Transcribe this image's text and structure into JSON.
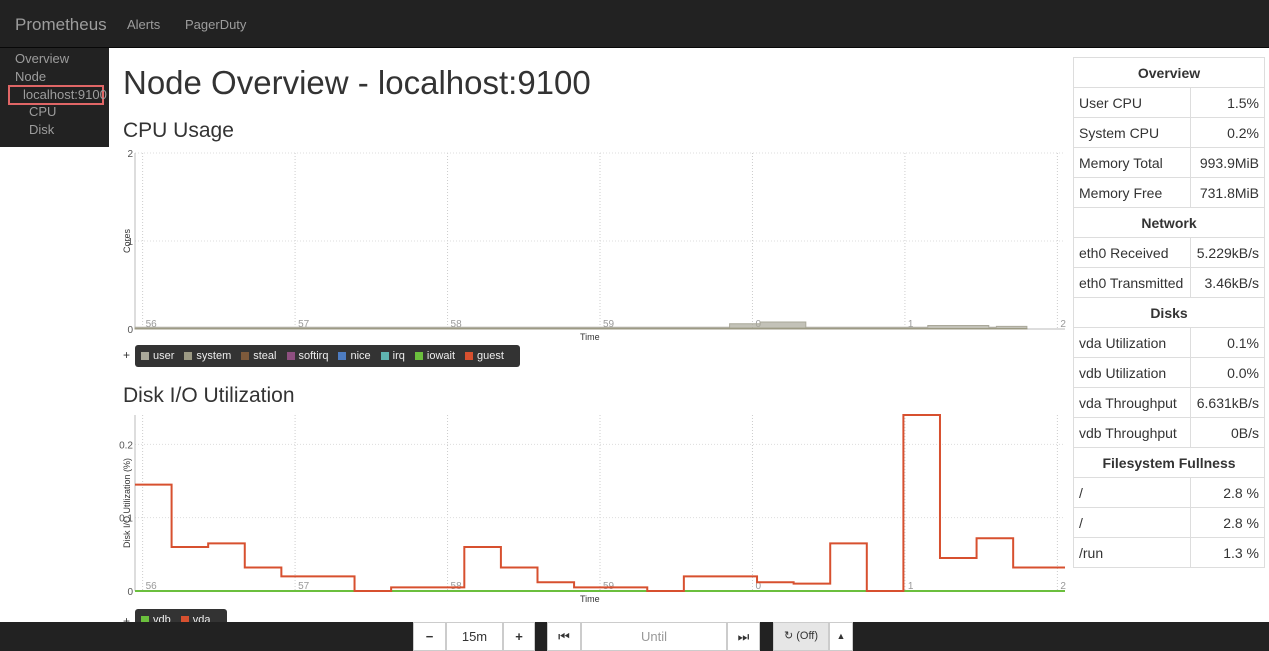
{
  "nav": {
    "brand": "Prometheus",
    "links": [
      "Alerts",
      "PagerDuty"
    ]
  },
  "sidebar": {
    "items": [
      "Overview",
      "Node",
      "localhost:9100",
      "CPU",
      "Disk"
    ]
  },
  "page_title": "Node Overview - localhost:9100",
  "sections": {
    "cpu_title": "CPU Usage",
    "disk_title": "Disk I/O Utilization"
  },
  "chart_data": [
    {
      "type": "area",
      "ylabel": "Cores",
      "xlabel": "Time",
      "ylim": [
        0,
        2
      ],
      "y_ticks": [
        {
          "value": 0,
          "label": "0"
        },
        {
          "value": 1,
          "label": "1"
        },
        {
          "value": 2,
          "label": "2"
        }
      ],
      "x_ticks": [
        "56",
        "57",
        "58",
        "59",
        "0",
        "1",
        "2"
      ],
      "x": [
        0.0,
        0.48,
        0.52,
        0.98,
        1.48,
        1.52,
        1.98,
        2.55,
        2.6,
        3.0,
        3.6,
        3.65,
        3.9,
        4.05,
        4.1,
        4.3,
        4.4,
        4.6,
        5.0,
        5.15,
        5.2,
        5.4,
        5.6,
        5.65,
        5.85
      ],
      "series": [
        {
          "name": "user",
          "color": "#aaa89a",
          "values": [
            0.02,
            0.02,
            0.02,
            0.02,
            0.02,
            0.02,
            0.02,
            0.02,
            0.02,
            0.02,
            0.02,
            0.02,
            0.06,
            0.06,
            0.08,
            0.08,
            0.02,
            0.02,
            0.02,
            0.02,
            0.04,
            0.04,
            0.02,
            0.03,
            0.03
          ]
        },
        {
          "name": "system",
          "color": "#9c9a84",
          "values": [
            0.005,
            0.005,
            0.005,
            0.005,
            0.005,
            0.005,
            0.005,
            0.005,
            0.005,
            0.005,
            0.005,
            0.005,
            0.01,
            0.01,
            0.01,
            0.01,
            0.005,
            0.005,
            0.005,
            0.005,
            0.005,
            0.005,
            0.005,
            0.005,
            0.005
          ]
        },
        {
          "name": "steal",
          "color": "#7e5a3b",
          "values": []
        },
        {
          "name": "softirq",
          "color": "#8e4f80",
          "values": []
        },
        {
          "name": "nice",
          "color": "#4d7cc1",
          "values": []
        },
        {
          "name": "irq",
          "color": "#5fb4b0",
          "values": []
        },
        {
          "name": "iowait",
          "color": "#6bbf3d",
          "values": []
        },
        {
          "name": "guest",
          "color": "#d7502f",
          "values": []
        }
      ]
    },
    {
      "type": "line",
      "ylabel": "Disk I/O Utilization (%)",
      "xlabel": "Time",
      "ylim": [
        0,
        0.24
      ],
      "y_ticks": [
        {
          "value": 0,
          "label": "0"
        },
        {
          "value": 0.1,
          "label": "0.1"
        },
        {
          "value": 0.2,
          "label": "0.2"
        }
      ],
      "x_ticks": [
        "56",
        "57",
        "58",
        "59",
        "0",
        "1",
        "2"
      ],
      "x": [
        0,
        0.24,
        0.48,
        0.72,
        0.96,
        1.2,
        1.44,
        1.68,
        1.92,
        2.16,
        2.4,
        2.64,
        2.88,
        3.12,
        3.36,
        3.6,
        3.84,
        4.08,
        4.32,
        4.56,
        4.8,
        5.04,
        5.28,
        5.52,
        5.76,
        6.0
      ],
      "series": [
        {
          "name": "vdb",
          "color": "#6bbf3d",
          "values": [
            0,
            0,
            0,
            0,
            0,
            0,
            0,
            0,
            0,
            0,
            0,
            0,
            0,
            0,
            0,
            0,
            0,
            0,
            0,
            0,
            0,
            0,
            0,
            0,
            0,
            0
          ]
        },
        {
          "name": "vda",
          "color": "#d7502f",
          "values": [
            0.145,
            0.06,
            0.065,
            0.032,
            0.02,
            0.02,
            0,
            0.005,
            0.005,
            0.06,
            0.032,
            0.012,
            0.005,
            0.005,
            0,
            0.02,
            0.02,
            0.012,
            0.01,
            0.065,
            0,
            0.24,
            0.045,
            0.072,
            0.032,
            0.032
          ]
        }
      ]
    }
  ],
  "stats": {
    "overview": {
      "title": "Overview",
      "rows": [
        [
          "User CPU",
          "1.5%"
        ],
        [
          "System CPU",
          "0.2%"
        ],
        [
          "Memory Total",
          "993.9MiB"
        ],
        [
          "Memory Free",
          "731.8MiB"
        ]
      ]
    },
    "network": {
      "title": "Network",
      "rows": [
        [
          "eth0 Received",
          "5.229kB/s"
        ],
        [
          "eth0 Transmitted",
          "3.46kB/s"
        ]
      ]
    },
    "disks": {
      "title": "Disks",
      "rows": [
        [
          "vda Utilization",
          "0.1%"
        ],
        [
          "vdb Utilization",
          "0.0%"
        ],
        [
          "vda Throughput",
          "6.631kB/s"
        ],
        [
          "vdb Throughput",
          "0B/s"
        ]
      ]
    },
    "filesystem": {
      "title": "Filesystem Fullness",
      "rows": [
        [
          "/",
          "2.8 %"
        ],
        [
          "/",
          "2.8 %"
        ],
        [
          "/run",
          "1.3 %"
        ]
      ]
    }
  },
  "controls": {
    "minus": "−",
    "range": "15m",
    "plus": "+",
    "back": "⏮",
    "until_placeholder": "Until",
    "forward": "⏭",
    "refresh": "↻ (Off)",
    "refresh_menu": "▲",
    "legend_add": "+"
  }
}
